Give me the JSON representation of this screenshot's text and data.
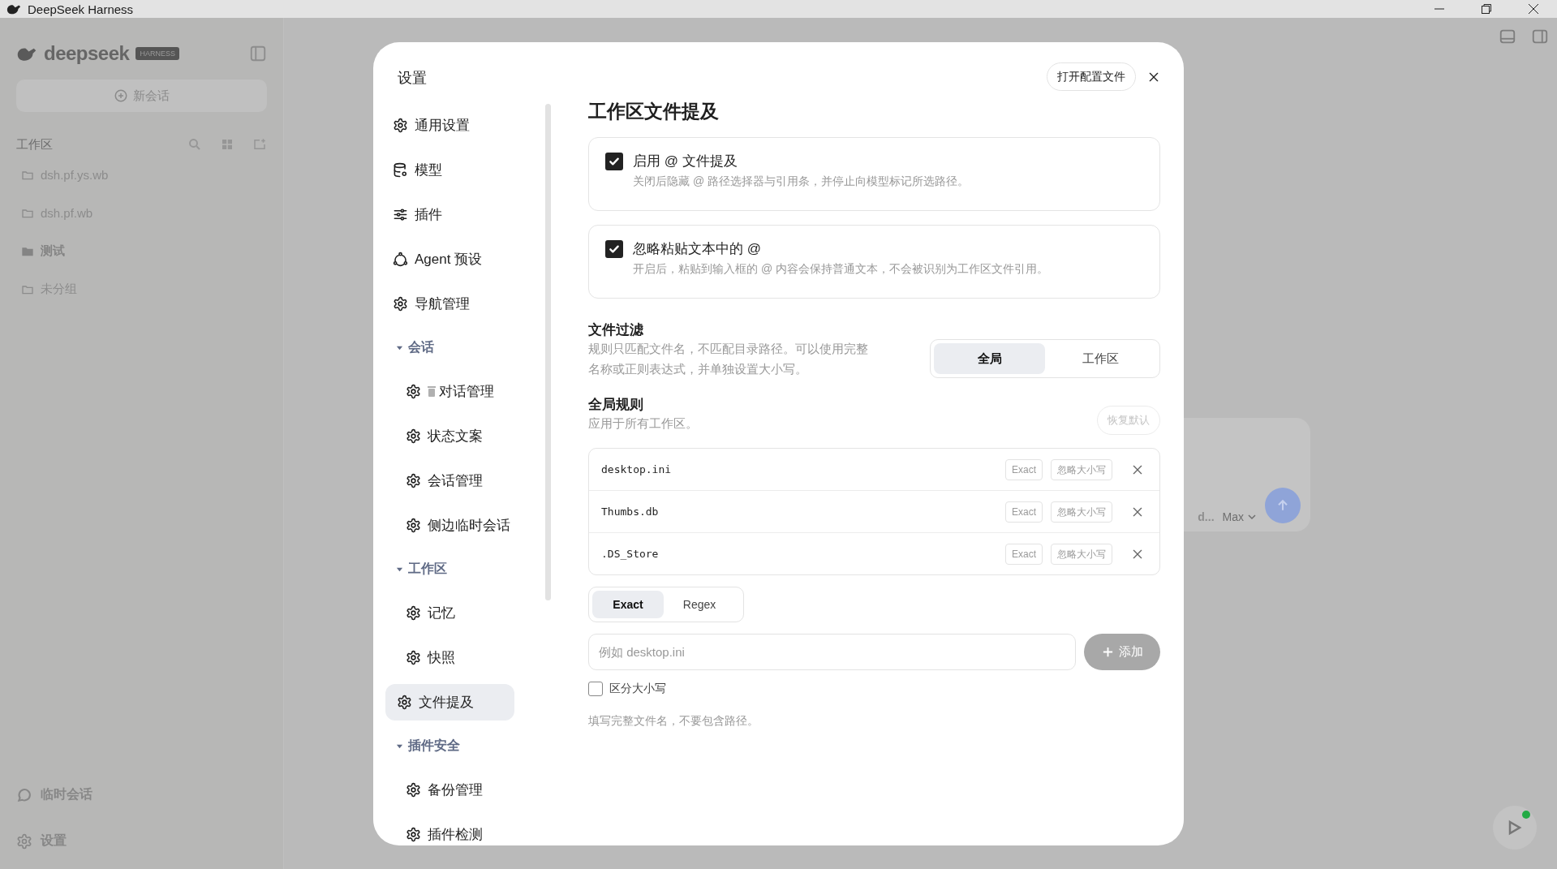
{
  "window": {
    "title": "DeepSeek Harness"
  },
  "background": {
    "brand": "deepseek",
    "brand_badge": "HARNESS",
    "new_chat": "新会话",
    "section_label": "工作区",
    "folders": [
      {
        "label": "dsh.pf.ys.wb",
        "kind": "closed"
      },
      {
        "label": "dsh.pf.wb",
        "kind": "closed"
      },
      {
        "label": "测试",
        "kind": "open"
      },
      {
        "label": "未分组",
        "kind": "closed"
      }
    ],
    "bottom_items": [
      {
        "kind": "chat",
        "label": "临时会话"
      },
      {
        "kind": "settings",
        "label": "设置"
      }
    ],
    "composer": {
      "model": "d...",
      "mode": "Max"
    }
  },
  "settings": {
    "title": "设置",
    "open_config_button": "打开配置文件",
    "nav": [
      {
        "kind": "gear",
        "label": "通用设置",
        "selected": false
      },
      {
        "kind": "database",
        "label": "模型",
        "selected": false
      },
      {
        "kind": "sliders",
        "label": "插件",
        "selected": false
      },
      {
        "kind": "nodes",
        "label": "Agent 预设",
        "selected": false
      },
      {
        "kind": "gear",
        "label": "导航管理",
        "selected": false
      },
      {
        "kind": "group",
        "label": "会话",
        "expanded": true,
        "children": [
          {
            "kind": "trash",
            "label": "对话管理",
            "selected": false
          },
          {
            "kind": "gear",
            "label": "状态文案",
            "selected": false
          },
          {
            "kind": "gear",
            "label": "会话管理",
            "selected": false
          },
          {
            "kind": "gear",
            "label": "侧边临时会话",
            "selected": false
          }
        ]
      },
      {
        "kind": "group",
        "label": "工作区",
        "expanded": true,
        "children": [
          {
            "kind": "gear",
            "label": "记忆",
            "selected": false
          },
          {
            "kind": "gear",
            "label": "快照",
            "selected": false
          },
          {
            "kind": "gear",
            "label": "文件提及",
            "selected": true
          }
        ]
      },
      {
        "kind": "group",
        "label": "插件安全",
        "expanded": true,
        "children": [
          {
            "kind": "gear",
            "label": "备份管理",
            "selected": false
          },
          {
            "kind": "gear",
            "label": "插件检测",
            "selected": false
          }
        ]
      }
    ],
    "heading": "工作区文件提及",
    "toggles": [
      {
        "label": "启用 @ 文件提及",
        "description": "关闭后隐藏 @ 路径选择器与引用条，并停止向模型标记所选路径。",
        "checked": true
      },
      {
        "label": "忽略粘贴文本中的 @",
        "description": "开启后，粘贴到输入框的 @ 内容会保持普通文本，不会被识别为工作区文件引用。",
        "checked": true
      }
    ],
    "filter": {
      "title": "文件过滤",
      "description": "规则只匹配文件名，不匹配目录路径。可以使用完整名称或正则表达式，并单独设置大小写。",
      "scopes": [
        {
          "label": "全局",
          "selected": true
        },
        {
          "label": "工作区",
          "selected": false
        }
      ]
    },
    "global_rules": {
      "title": "全局规则",
      "subtitle": "应用于所有工作区。",
      "reset_button": {
        "label": "恢复默认",
        "disabled": true
      },
      "rules": [
        {
          "pattern": "desktop.ini",
          "match": "Exact",
          "case": "忽略大小写"
        },
        {
          "pattern": "Thumbs.db",
          "match": "Exact",
          "case": "忽略大小写"
        },
        {
          "pattern": ".DS_Store",
          "match": "Exact",
          "case": "忽略大小写"
        }
      ],
      "modes": [
        {
          "label": "Exact",
          "selected": true
        },
        {
          "label": "Regex",
          "selected": false
        }
      ],
      "input": {
        "placeholder": "例如 desktop.ini"
      },
      "add_button": {
        "label": "添加",
        "disabled": true
      },
      "case_sensitive": {
        "label": "区分大小写",
        "checked": false
      },
      "hint": "填写完整文件名，不要包含路径。"
    }
  }
}
